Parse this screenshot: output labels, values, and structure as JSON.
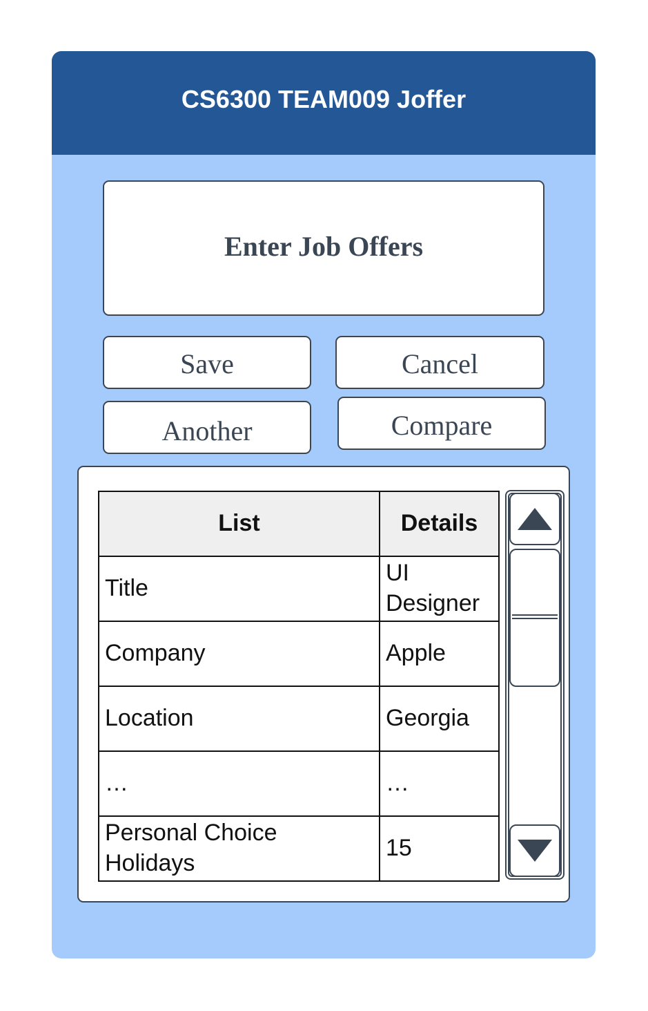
{
  "app": {
    "title": "CS6300 TEAM009 Joffer"
  },
  "form": {
    "heading": "Enter Job Offers",
    "buttons": {
      "save": "Save",
      "cancel": "Cancel",
      "another": "Another",
      "compare": "Compare"
    }
  },
  "table": {
    "headers": [
      "List",
      "Details"
    ],
    "rows": [
      {
        "label": "Title",
        "value": "UI Designer"
      },
      {
        "label": "Company",
        "value": "Apple"
      },
      {
        "label": "Location",
        "value": "Georgia"
      },
      {
        "label": "…",
        "value": "…"
      },
      {
        "label": "Personal Choice Holidays",
        "value": "15"
      }
    ]
  },
  "scrollbar": {
    "up_icon": "triangle-up-icon",
    "down_icon": "triangle-down-icon"
  },
  "colors": {
    "titlebar": "#245796",
    "background": "#a4cbfc",
    "border": "#3b4654"
  }
}
